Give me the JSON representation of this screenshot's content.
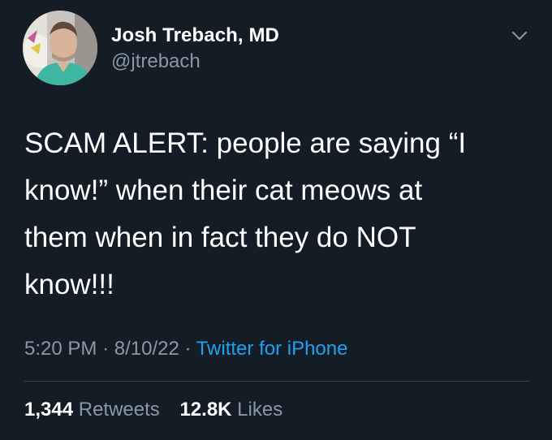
{
  "author": {
    "display_name": "Josh Trebach, MD",
    "handle": "@jtrebach"
  },
  "icons": {
    "menu": "chevron-down-icon"
  },
  "tweet": {
    "text": "SCAM ALERT: people are saying “I\nknow!” when their cat meows at\nthem when in fact they do NOT\nknow!!!",
    "time": "5:20 PM",
    "separator": "·",
    "date": "8/10/22",
    "source": "Twitter for iPhone"
  },
  "stats": {
    "retweets_count": "1,344",
    "retweets_label": "Retweets",
    "likes_count": "12.8K",
    "likes_label": "Likes"
  },
  "colors": {
    "background": "#141d26",
    "text_primary": "#ffffff",
    "text_secondary": "#8899a6",
    "link": "#1da1f2",
    "divider": "#38444d"
  }
}
